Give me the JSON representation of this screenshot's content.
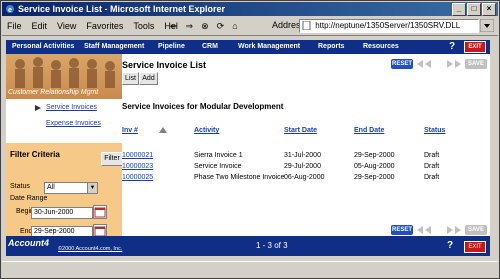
{
  "window": {
    "title": "Service Invoice List - Microsoft Internet Explorer"
  },
  "menubar": {
    "items": [
      "File",
      "Edit",
      "View",
      "Favorites",
      "Tools",
      "Hel"
    ],
    "address_label": "Address",
    "address_value": "http://neptune/1350Server/1350SRV.DLL"
  },
  "topnav": {
    "items": [
      "Personal Activities",
      "Staff Management",
      "Pipeline",
      "CRM",
      "Work Management",
      "Reports",
      "Resources"
    ],
    "help_icon": "?",
    "exit_label": "EXIT"
  },
  "sidebar": {
    "logo_text": "Customer Relationship Mgmt",
    "links": [
      {
        "label": "Service Invoices"
      },
      {
        "label": "Expense Invoices"
      }
    ],
    "filter": {
      "title": "Filter Criteria",
      "button": "Filter",
      "status_label": "Status",
      "status_value": "All",
      "date_range_label": "Date Range",
      "begin_label": "Begin",
      "begin_value": "30-Jun-2000",
      "end_label": "End",
      "end_value": "29-Sep-2000"
    }
  },
  "main": {
    "title": "Service Invoice List",
    "buttons": {
      "list": "List",
      "add": "Add"
    },
    "top_controls": {
      "reset": "RESET",
      "save": "SAVE"
    },
    "section_title": "Service Invoices for Modular Development",
    "columns": [
      "Inv #",
      "Activity",
      "Start Date",
      "End Date",
      "Status"
    ],
    "rows": [
      {
        "inv": "10000021",
        "activity": "Sierra Invoice 1",
        "start": "31-Jul-2000",
        "end": "29-Sep-2000",
        "status": "Draft"
      },
      {
        "inv": "10000023",
        "activity": "Service Invoice",
        "start": "29-Jul-2000",
        "end": "05-Aug-2000",
        "status": "Draft"
      },
      {
        "inv": "10000025",
        "activity": "Phase Two Milestone Invoice",
        "start": "06-Aug-2000",
        "end": "29-Sep-2000",
        "status": "Draft"
      }
    ],
    "bottom_controls": {
      "reset": "RESET",
      "save": "SAVE",
      "help": "?",
      "exit": "EXIT"
    }
  },
  "footer": {
    "logo": "Account4",
    "copyright": "©2000 Account4.com, Inc.",
    "pager": "1 - 3 of 3"
  },
  "colors": {
    "nav_blue": "#0e2f85",
    "sidebar_orange": "#f7c988",
    "link_blue": "#1a3fb0",
    "exit_red": "#c81818"
  }
}
